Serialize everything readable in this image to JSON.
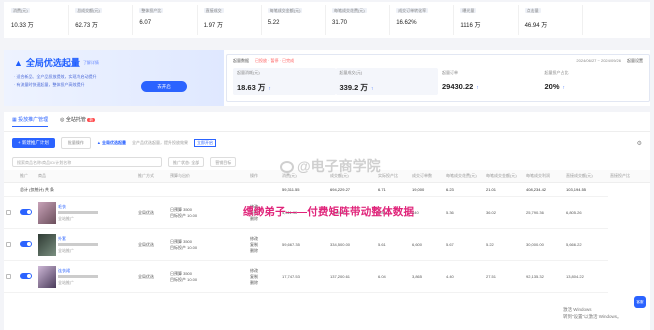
{
  "top_stats": [
    {
      "label": "消费(元)",
      "value": "10.33 万"
    },
    {
      "label": "总成交额(元)",
      "value": "62.73 万"
    },
    {
      "label": "整体投产比",
      "value": "6.07"
    },
    {
      "label": "直接成交",
      "value": "1.97 万"
    },
    {
      "label": "每笔成交金额(元)",
      "value": "5.22"
    },
    {
      "label": "每笔成交花费(元)",
      "value": "31.70"
    },
    {
      "label": "成交订单转化率",
      "value": "16.62%"
    },
    {
      "label": "曝光量",
      "value": "1116 万"
    },
    {
      "label": "点击量",
      "value": "46.94 万"
    }
  ],
  "promo": {
    "title": "全局优选起量",
    "title_link": "了解详情",
    "desc_line1": "· 适合新品、全产品投放提效，实现冷启动提升",
    "desc_line2": "· 有流量时快速起量，整体投产高效提升",
    "button": "去开启",
    "right_label": "起量数据",
    "right_warn": "已投放 · 暂停 · 已完成",
    "right_date": "2024/06/27 ~ 2024/09/26",
    "right_link": "起量设置",
    "metrics": [
      {
        "label": "起量消耗(元)",
        "value": "18.63 万"
      },
      {
        "label": "起量成交(元)",
        "value": "339.2 万"
      },
      {
        "label": "起量订单",
        "value": "29430.22"
      },
      {
        "label": "起量投产占比",
        "value": "20%"
      }
    ]
  },
  "tabs": [
    {
      "label": "投放推广管理"
    },
    {
      "label": "全站托管",
      "badge": "新"
    }
  ],
  "toolbar": {
    "new_button": "+ 新建推广计划",
    "batch_button": "批量操作",
    "quanyu": "全局优选起量",
    "hint": "全产品优选起量，提升投放效果",
    "link": "立即开启"
  },
  "filters": {
    "search_placeholder": "搜索商品名称/商品ID/计划名称",
    "select1": "推广状态: 全部",
    "select2": "营销目标"
  },
  "table": {
    "headers": [
      "",
      "推广",
      "商品",
      "推广方式",
      "预算与出价",
      "操作",
      "消费(元)",
      "成交额(元)",
      "实际投产比",
      "成交订单数",
      "每笔成交花费(元)",
      "每笔成交金额(元)",
      "每笔成交利润",
      "直接成交额(元)",
      "直接投产比"
    ],
    "summary": {
      "label": "总计 (仅统计) 共 条",
      "cols": [
        "",
        "",
        "",
        "",
        "59,311.55",
        "694,229.27",
        "6.71",
        "19,000",
        "6.23",
        "21.01",
        "408,234.42",
        "103,194.55"
      ]
    },
    "rows": [
      {
        "name": "毛衣",
        "tag": "全站推广",
        "method": "全局优选",
        "budget": "日预算 3500",
        "bid": "目标投产 10.00",
        "ops": [
          "修改",
          "复制",
          "删除"
        ],
        "cols": [
          "4,611.90",
          "31,500.61",
          "6.83",
          "840",
          "5.36",
          "36.02",
          "25,790.36",
          "6,805.26"
        ]
      },
      {
        "name": "外套",
        "tag": "全站推广",
        "method": "全局优选",
        "budget": "日预算 3500",
        "bid": "目标投产 10.00",
        "ops": [
          "修改",
          "复制",
          "删除"
        ],
        "cols": [
          "59,667.35",
          "334,500.00",
          "5.61",
          "6,600",
          "5.67",
          "5.22",
          "30,000.00",
          "5,666.22"
        ]
      },
      {
        "name": "连衣裙",
        "tag": "全站推广",
        "method": "全局优选",
        "budget": "日预算 3500",
        "bid": "目标投产 10.00",
        "ops": [
          "修改",
          "复制",
          "删除"
        ],
        "cols": [
          "17,747.53",
          "137,200.61",
          "6.04",
          "3,865",
          "4.40",
          "27.51",
          "92,135.32",
          "13,804.22"
        ]
      }
    ]
  },
  "overlay_text": "缥缈弟子——付费矩阵带动整体数据",
  "watermark": "@电子商学院",
  "activate_line1": "激活 Windows",
  "activate_line2": "转到“设置”以激活 Windows。",
  "float_button": "客服"
}
